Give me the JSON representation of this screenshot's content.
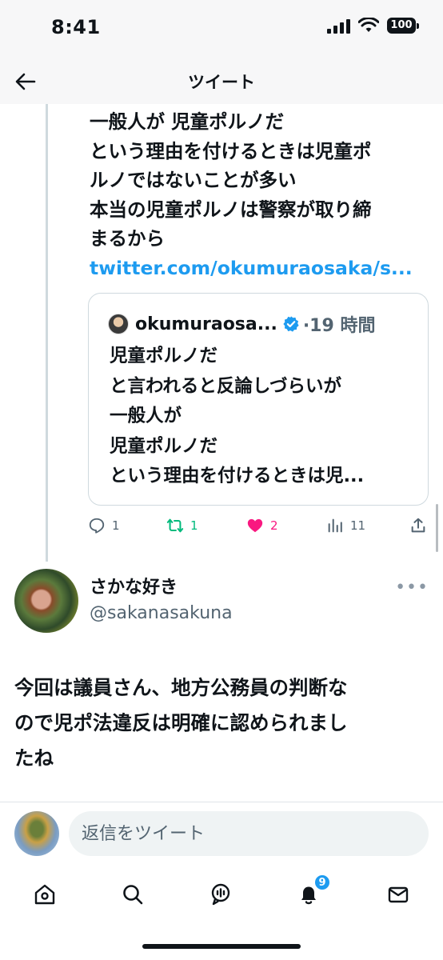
{
  "status_bar": {
    "time": "8:41",
    "battery": "100"
  },
  "header": {
    "title": "ツイート",
    "back_icon": "arrow-left-icon"
  },
  "parent_tweet": {
    "lines": [
      "一般人が 児童ポルノだ",
      "という理由を付けるときは児童ポ",
      "ルノではないことが多い",
      "本当の児童ポルノは警察が取り締",
      "まるから"
    ],
    "link": "twitter.com/okumuraosaka/s..."
  },
  "quoted_tweet": {
    "name": "okumuraosa...",
    "time": "·19 時間",
    "lines": [
      "児童ポルノだ",
      "と言われると反論しづらいが",
      "一般人が",
      "児童ポルノだ",
      "という理由を付けるときは児..."
    ]
  },
  "actions": {
    "replies": "1",
    "retweets": "1",
    "likes": "2",
    "views": "11"
  },
  "main_tweet": {
    "name": "さかな好き",
    "handle": "@sakanasakuna",
    "lines": [
      "今回は議員さん、地方公務員の判断な",
      "ので児ポ法違反は明確に認められまし",
      "たね"
    ]
  },
  "reply_box": {
    "placeholder": "返信をツイート"
  },
  "tab_bar": {
    "notifications_badge": "9"
  },
  "colors": {
    "accent": "#1d9bf0",
    "retweet": "#00ba7c",
    "like": "#f91880",
    "secondary_text": "#536471"
  }
}
